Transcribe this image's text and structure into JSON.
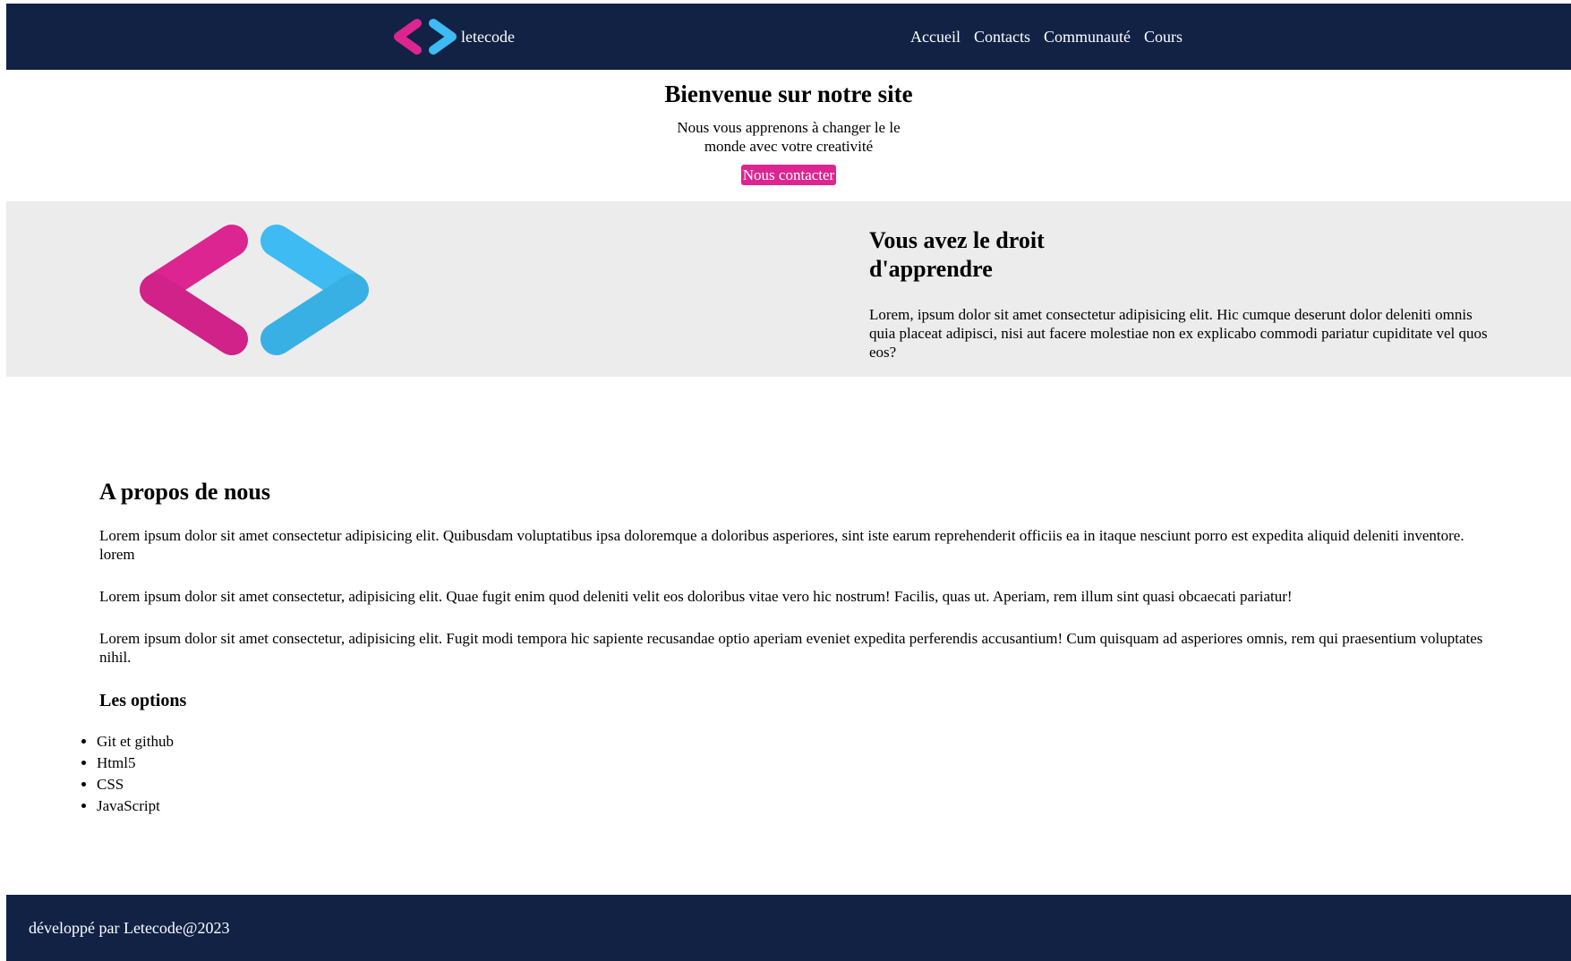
{
  "header": {
    "brand_name": "letecode",
    "logo_icon": "code-brackets-logo-icon",
    "nav": [
      "Accueil",
      "Contacts",
      "Communauté",
      "Cours"
    ]
  },
  "welcome": {
    "title": "Bienvenue sur notre site",
    "subtitle": "Nous vous apprenons à changer le le monde avec votre creativité",
    "cta_label": "Nous contacter"
  },
  "band": {
    "title": "Vous avez le droit d'apprendre",
    "text": "Lorem, ipsum dolor sit amet consectetur adipisicing elit. Hic cumque deserunt dolor deleniti omnis quia placeat adipisci, nisi aut facere molestiae non ex explicabo commodi pariatur cupiditate vel quos eos?"
  },
  "about": {
    "title": "A propos de nous",
    "paragraphs": [
      "Lorem ipsum dolor sit amet consectetur adipisicing elit. Quibusdam voluptatibus ipsa doloremque a doloribus asperiores, sint iste earum reprehenderit officiis ea in itaque nesciunt porro est expedita aliquid deleniti inventore. lorem",
      "Lorem ipsum dolor sit amet consectetur, adipisicing elit. Quae fugit enim quod deleniti velit eos doloribus vitae vero hic nostrum! Facilis, quas ut. Aperiam, rem illum sint quasi obcaecati pariatur!",
      "Lorem ipsum dolor sit amet consectetur, adipisicing elit. Fugit modi tempora hic sapiente recusandae optio aperiam eveniet expedita perferendis accusantium! Cum quisquam ad asperiores omnis, rem qui praesentium voluptates nihil."
    ],
    "options_title": "Les options",
    "options": [
      "Git et github",
      "Html5",
      "CSS",
      "JavaScript"
    ]
  },
  "footer": {
    "text": "développé par Letecode@2023"
  },
  "colors": {
    "navy": "#112245",
    "pink": "#dd2591",
    "blue": "#3dbbf2",
    "band_bg": "#ececec"
  }
}
